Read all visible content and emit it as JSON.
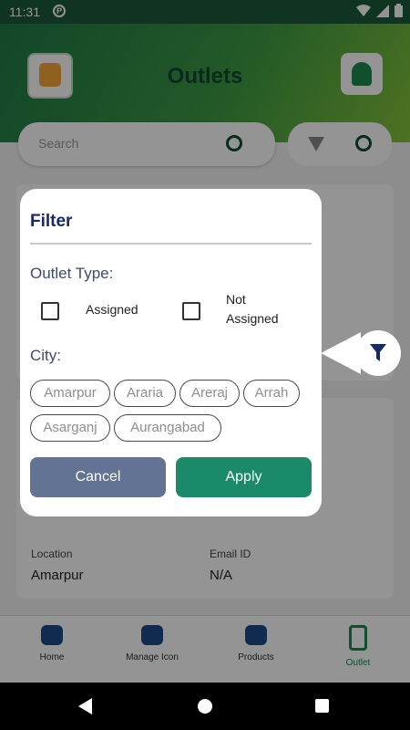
{
  "status_bar": {
    "time": "11:31",
    "app_badge": "P"
  },
  "app": {
    "header_title": "Outlets",
    "search_placeholder": "Search",
    "cards": [
      {
        "label_left": "Location",
        "value_left": "Amarpur",
        "label_right": "Email ID",
        "value_right": "N/A"
      }
    ],
    "bottom_nav": [
      {
        "label": "Home"
      },
      {
        "label": "Manage Icon"
      },
      {
        "label": "Products"
      },
      {
        "label": "Outlet"
      }
    ]
  },
  "filter_dialog": {
    "title": "Filter",
    "outlet_type_label": "Outlet Type:",
    "outlet_types": [
      {
        "label": "Assigned",
        "checked": false
      },
      {
        "label": "Not\nAssigned",
        "checked": false
      }
    ],
    "city_label": "City:",
    "cities": [
      "Amarpur",
      "Araria",
      "Areraj",
      "Arrah",
      "Asarganj",
      "Aurangabad"
    ],
    "cancel_label": "Cancel",
    "apply_label": "Apply"
  },
  "colors": {
    "title_navy": "#16296b",
    "cancel_btn": "#627394",
    "apply_btn": "#1a8a6a",
    "header_green": "#1f7a48"
  },
  "icons": {
    "fab": "filter-icon",
    "search": "search-icon",
    "refresh": "refresh-icon"
  }
}
